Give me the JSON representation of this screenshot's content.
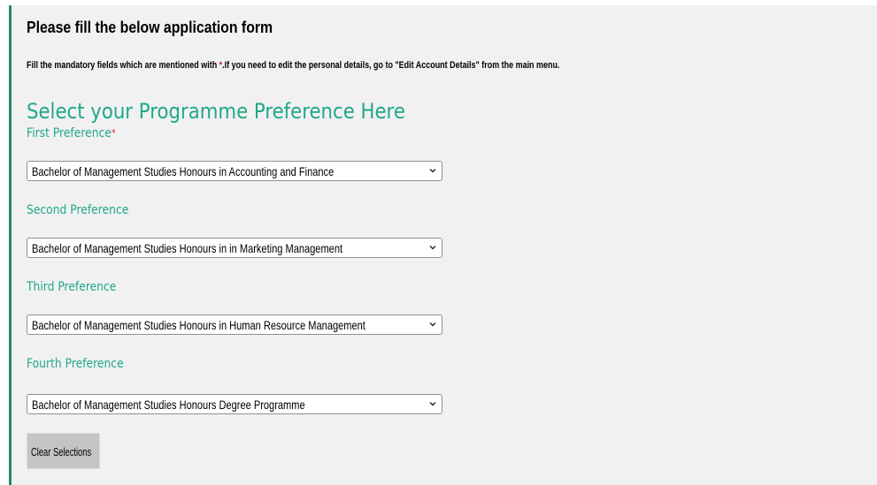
{
  "form": {
    "title": "Please fill the below application form",
    "instructions": {
      "before_marker": "Fill the mandatory fields which are mentioned with ",
      "required_marker": "*",
      "after_marker": ".If you need to edit the personal details, go to \"Edit Account Details\" from the main menu."
    },
    "section_heading": "Select your Programme Preference Here",
    "required_marker": "*",
    "colors": {
      "accent": "#1fa88a",
      "left_border": "#1e8c6c",
      "required": "#e0202a",
      "panel_background": "#f1f1f1"
    },
    "preferences": [
      {
        "label": "First Preference",
        "required": true,
        "selected": "Bachelor of Management Studies Honours in Accounting and Finance"
      },
      {
        "label": "Second Preference",
        "required": false,
        "selected": "Bachelor of Management Studies Honours in in Marketing Management"
      },
      {
        "label": "Third Preference",
        "required": false,
        "selected": "Bachelor of Management Studies Honours in Human Resource Management"
      },
      {
        "label": "Fourth Preference",
        "required": false,
        "selected": "Bachelor of Management Studies Honours Degree Programme"
      }
    ],
    "dropdown_icon": "chevron-down-icon",
    "clear_button_label": "Clear Selections"
  }
}
